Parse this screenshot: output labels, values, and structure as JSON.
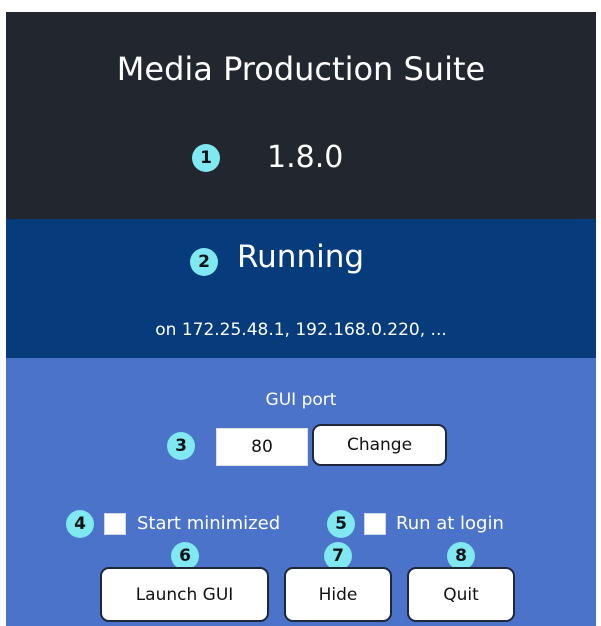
{
  "header": {
    "title": "Media Production Suite",
    "version": "1.8.0"
  },
  "status": {
    "state": "Running",
    "addresses": "on 172.25.48.1, 192.168.0.220, ..."
  },
  "port": {
    "label": "GUI port",
    "value": "80",
    "change_label": "Change"
  },
  "options": {
    "start_minimized": {
      "label": "Start minimized",
      "checked": false
    },
    "run_at_login": {
      "label": "Run at login",
      "checked": false
    }
  },
  "actions": {
    "launch_label": "Launch GUI",
    "hide_label": "Hide",
    "quit_label": "Quit"
  },
  "annotations": {
    "badge_1": "1",
    "badge_2": "2",
    "badge_3": "3",
    "badge_4": "4",
    "badge_5": "5",
    "badge_6": "6",
    "badge_7": "7",
    "badge_8": "8"
  },
  "colors": {
    "header_bg": "#22262e",
    "status_bg": "#063b7c",
    "controls_bg": "#4a73c9",
    "badge_bg": "#7fe8f0",
    "button_border": "#1e2838"
  }
}
